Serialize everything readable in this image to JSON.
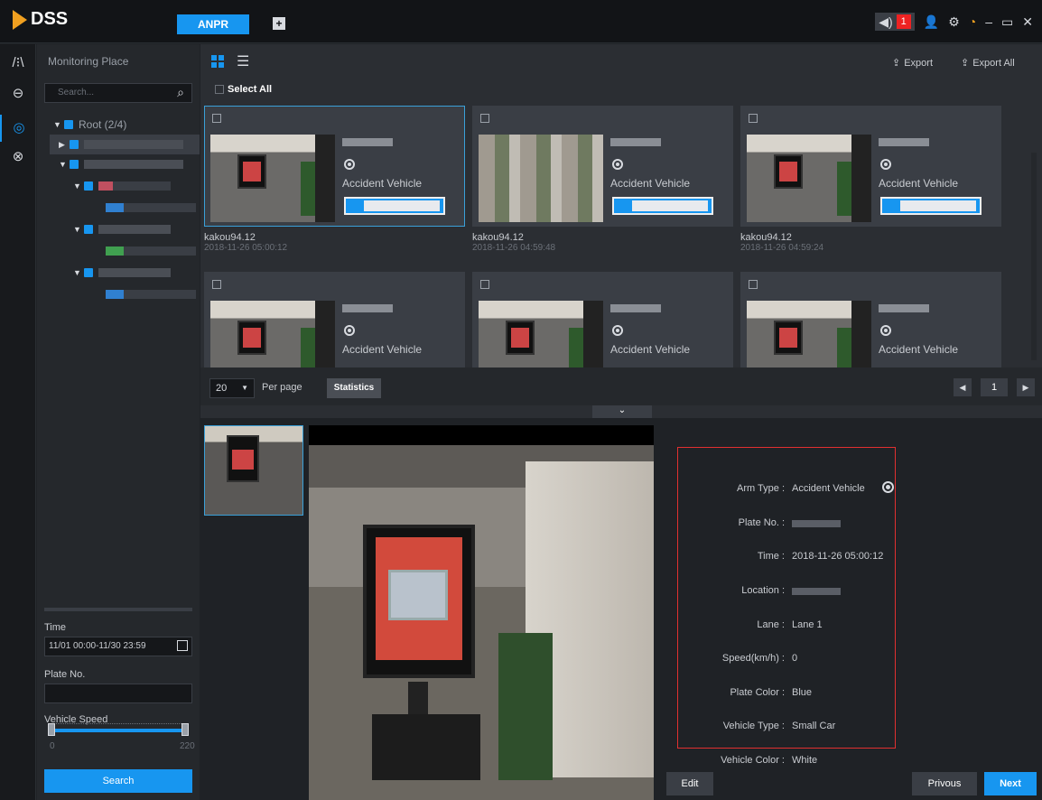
{
  "app": {
    "logo": "DSS",
    "active_tab": "ANPR",
    "add_tab": "+"
  },
  "topbar": {
    "alarm_count": "1",
    "icons": [
      "speaker-icon",
      "user-icon",
      "gear-icon",
      "gauge-icon",
      "minimize-icon",
      "restore-icon",
      "close-icon"
    ],
    "minimize": "–",
    "restore": "▭",
    "close": "✕"
  },
  "iconbar": {
    "items": [
      "road-icon",
      "steering-wheel-icon",
      "speed-icon",
      "vehicle-icon"
    ]
  },
  "left": {
    "title": "Monitoring Place",
    "search_placeholder": "Search...",
    "root_label": "Root (2/4)",
    "time_label": "Time",
    "time_value": "11/01 00:00-11/30 23:59",
    "plate_label": "Plate No.",
    "plate_value": "",
    "speed_label": "Vehicle Speed",
    "speed_min": "0",
    "speed_max": "220",
    "search_button": "Search"
  },
  "toolbar": {
    "export": "Export",
    "export_all": "Export All",
    "select_all": "Select All"
  },
  "cards": [
    {
      "arm_type": "Accident Vehicle",
      "name": "kakou94.12",
      "time": "2018-11-26 05:00:12"
    },
    {
      "arm_type": "Accident Vehicle",
      "name": "kakou94.12",
      "time": "2018-11-26 04:59:48"
    },
    {
      "arm_type": "Accident Vehicle",
      "name": "kakou94.12",
      "time": "2018-11-26 04:59:24"
    },
    {
      "arm_type": "Accident Vehicle"
    },
    {
      "arm_type": "Accident Vehicle"
    },
    {
      "arm_type": "Accident Vehicle"
    }
  ],
  "pager": {
    "per_page": "20",
    "per_page_label": "Per page",
    "statistics": "Statistics",
    "page": "1",
    "prev": "◀",
    "next": "▶"
  },
  "detail": {
    "arm_type_label": "Arm Type :",
    "arm_type": "Accident Vehicle",
    "plate_label": "Plate No. :",
    "time_label": "Time :",
    "time": "2018-11-26 05:00:12",
    "location_label": "Location :",
    "lane_label": "Lane :",
    "lane": "Lane 1",
    "speed_label": "Speed(km/h) :",
    "speed": "0",
    "plate_color_label": "Plate Color :",
    "plate_color": "Blue",
    "vehicle_type_label": "Vehicle Type :",
    "vehicle_type": "Small Car",
    "vehicle_color_label": "Vehicle Color :",
    "vehicle_color": "White"
  },
  "actions": {
    "edit": "Edit",
    "previous": "Privous",
    "next": "Next"
  },
  "colors": {
    "accent": "#1796f0",
    "alarm": "#e22222",
    "highlight_border": "#e03030"
  }
}
